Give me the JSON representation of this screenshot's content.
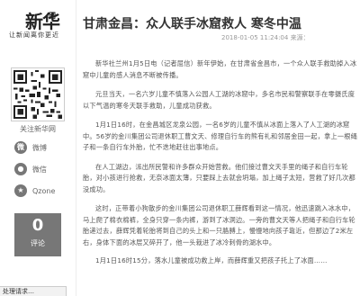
{
  "brand": {
    "logo_text": "新华",
    "logo_small": "网",
    "slogan": "让新闻离你更近"
  },
  "sidebar": {
    "follow_label": "关注新华网",
    "share": [
      {
        "icon": "weibo-icon",
        "label": "微博"
      },
      {
        "icon": "wechat-icon",
        "label": "微信"
      },
      {
        "icon": "qzone-icon",
        "label": "Qzone"
      }
    ],
    "comment_count": "0",
    "comment_label": "评论"
  },
  "article": {
    "title": "甘肃金昌：众人联手冰窟救人 寒冬中温",
    "meta": "2018-01-05 11:24:04   来源：",
    "paragraphs": [
      "新华社兰州1月5日电（记者屈信）新年伊始，在甘肃省金昌市，一个众人联手救助掉入冰窟中儿童的感人消息不断被传播。",
      "元旦当天，一名六岁儿童不慎落入公园人工湖的冰窟中，多名市民和警察联手在零摄氏度以下气温的寒冬天联手救助，儿童成功获救。",
      "1月1日16时，在金昌城区龙泉公园，一名6岁的儿童不慎从冰面上落入了人工湖的冰窟中。56岁的金川集团公司退休职工曹文天、修理自行车的熊有礼和邻居金田一起，拿上一根绳子和一条自行车外胎，忙不迭地赶往出事地点。",
      "在人工湖边，派出所民警和许多群众开始营救。他们接过曹文天手里的绳子和自行车轮胎，对小孩进行抢救，无奈冰面太薄，只要踩上去就会坍塌，加上绳子太短，营救了好几次都没成功。",
      "这时，正带着小狗散步的金川集团公司退休职工薛辉看到这一情况，他迅速跳入冰水中，马上爬了棉衣棉裤，全身只穿一条内裤，游到了冰洞边。一旁的曹文天等人把绳子和自行车轮胎递过去，薛辉凭着轮胎将到自己的头上和一只胳膊上，慢慢地向孩子靠近，但那边了2米左右，身体下面的冰层又碎开了，他一头栽进了冰冷刺骨的湖水中。",
      "1月1日16时15分，落水儿童被成功救上岸，而薛辉重又把孩子托上了冰面……"
    ]
  },
  "status_bar": {
    "text": "处理请求…"
  }
}
